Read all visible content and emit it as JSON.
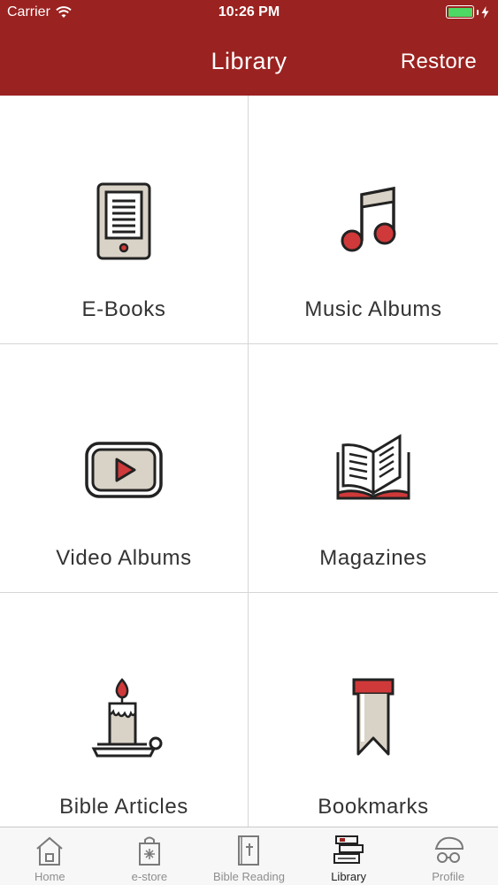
{
  "status_bar": {
    "carrier": "Carrier",
    "time": "10:26 PM"
  },
  "nav": {
    "title": "Library",
    "restore_label": "Restore"
  },
  "colors": {
    "header": "#9a2220",
    "accent_red": "#d0393a",
    "beige": "#d9d2c6",
    "battery": "#4cd964"
  },
  "library_items": [
    {
      "label": "E-Books",
      "icon": "ebook-reader-icon"
    },
    {
      "label": "Music Albums",
      "icon": "music-note-icon"
    },
    {
      "label": "Video Albums",
      "icon": "video-play-icon"
    },
    {
      "label": "Magazines",
      "icon": "open-book-icon"
    },
    {
      "label": "Bible Articles",
      "icon": "candle-icon"
    },
    {
      "label": "Bookmarks",
      "icon": "bookmark-ribbon-icon"
    }
  ],
  "tabs": [
    {
      "label": "Home",
      "icon": "home-icon",
      "active": false
    },
    {
      "label": "e-store",
      "icon": "shopping-bag-icon",
      "active": false
    },
    {
      "label": "Bible Reading",
      "icon": "bible-icon",
      "active": false
    },
    {
      "label": "Library",
      "icon": "books-icon",
      "active": true
    },
    {
      "label": "Profile",
      "icon": "profile-icon",
      "active": false
    }
  ]
}
